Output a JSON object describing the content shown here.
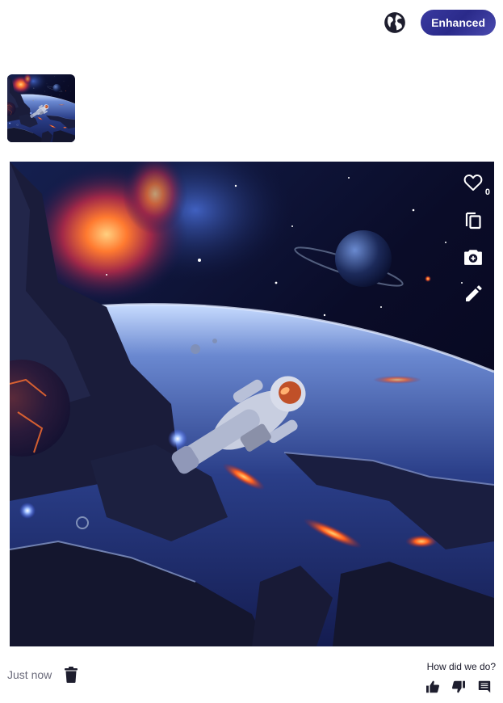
{
  "header": {
    "language_icon": "globe-icon",
    "enhanced_label": "Enhanced",
    "enhanced_color": "#2e2e90"
  },
  "thumbnail": {
    "alt": "Astronaut floating in space thumbnail"
  },
  "image": {
    "alt": "Astronaut floating above a planet among rocky asteroids and nebula",
    "actions": [
      {
        "icon": "heart-outline-icon",
        "label": "Like",
        "count": "0"
      },
      {
        "icon": "copy-icon",
        "label": "Copy"
      },
      {
        "icon": "add-photo-icon",
        "label": "Use as reference"
      },
      {
        "icon": "pencil-icon",
        "label": "Edit"
      }
    ]
  },
  "footer": {
    "timestamp": "Just now",
    "delete_icon": "trash-icon",
    "feedback_question": "How did we do?",
    "feedback_icons": [
      "thumbs-up-icon",
      "thumbs-down-icon",
      "comment-icon"
    ],
    "icon_color": "#1e1e2e"
  }
}
